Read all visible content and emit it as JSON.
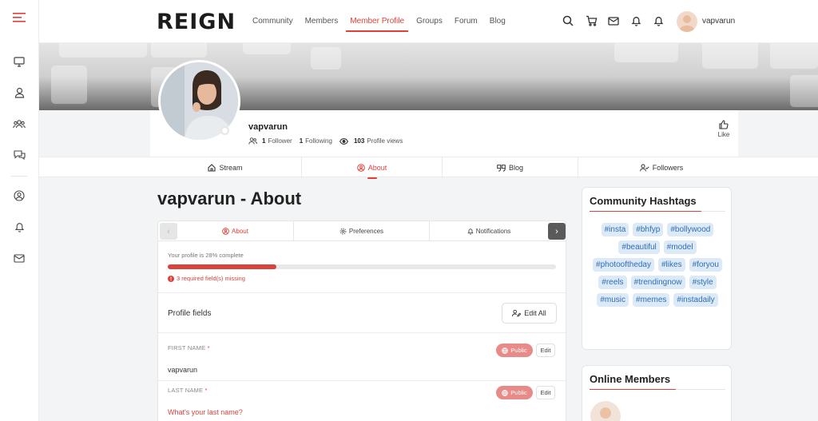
{
  "brand": {
    "logo": "REIGN",
    "accent": "#e0403a"
  },
  "nav": {
    "items": [
      {
        "label": "Community"
      },
      {
        "label": "Members"
      },
      {
        "label": "Member Profile",
        "active": true
      },
      {
        "label": "Groups"
      },
      {
        "label": "Forum"
      },
      {
        "label": "Blog"
      }
    ]
  },
  "header": {
    "username": "vapvarun"
  },
  "profile": {
    "name": "vapvarun",
    "followers_count": "1",
    "followers_label": "Follower",
    "following_count": "1",
    "following_label": "Following",
    "views_count": "103",
    "views_label": "Profile views",
    "like_label": "Like"
  },
  "subtabs": [
    {
      "label": "Stream"
    },
    {
      "label": "About",
      "active": true
    },
    {
      "label": "Blog"
    },
    {
      "label": "Followers"
    }
  ],
  "page_title": "vapvarun - About",
  "about": {
    "tabs": [
      {
        "label": "About",
        "active": true
      },
      {
        "label": "Preferences"
      },
      {
        "label": "Notifications"
      }
    ],
    "progress_label": "Your profile is 28% complete",
    "progress_percent": 28,
    "missing_text": "3 required field(s) missing",
    "section_title": "Profile fields",
    "edit_all_label": "Edit All",
    "fields": [
      {
        "label": "FIRST NAME",
        "required": "*",
        "visibility": "Public",
        "edit": "Edit",
        "value": "vapvarun"
      },
      {
        "label": "LAST NAME",
        "required": "*",
        "visibility": "Public",
        "edit": "Edit",
        "value": "What's your last name?"
      }
    ]
  },
  "hashtags": {
    "title": "Community Hashtags",
    "items": [
      "#insta",
      "#bhfyp",
      "#bollywood",
      "#beautiful",
      "#model",
      "#photooftheday",
      "#likes",
      "#foryou",
      "#reels",
      "#trendingnow",
      "#style",
      "#music",
      "#memes",
      "#instadaily"
    ]
  },
  "online_members": {
    "title": "Online Members"
  }
}
